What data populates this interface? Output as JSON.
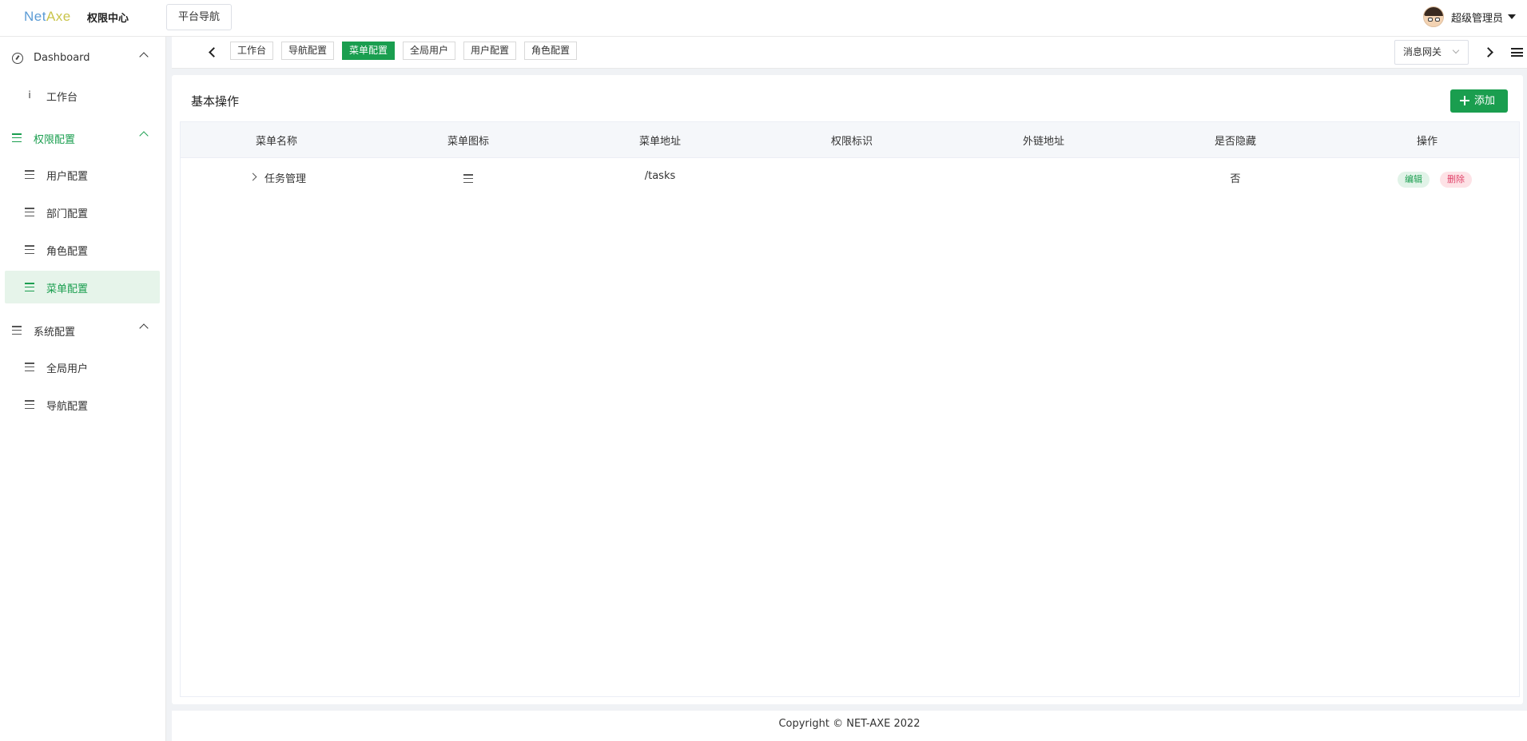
{
  "header": {
    "logo_text_a": "Net",
    "logo_text_b": "Axe",
    "app_title": "权限中心",
    "nav_button": "平台导航",
    "user_name": "超级管理员"
  },
  "sidebar": {
    "groups": [
      {
        "label": "Dashboard",
        "icon": "dashboard-icon",
        "expanded": true,
        "items": [
          {
            "label": "工作台",
            "icon": "info-icon"
          }
        ]
      },
      {
        "label": "权限配置",
        "icon": "menu-icon",
        "expanded": true,
        "active": true,
        "items": [
          {
            "label": "用户配置",
            "icon": "menu-icon"
          },
          {
            "label": "部门配置",
            "icon": "menu-icon"
          },
          {
            "label": "角色配置",
            "icon": "menu-icon"
          },
          {
            "label": "菜单配置",
            "icon": "menu-icon",
            "active": true
          }
        ]
      },
      {
        "label": "系统配置",
        "icon": "menu-icon",
        "expanded": true,
        "items": [
          {
            "label": "全局用户",
            "icon": "menu-icon"
          },
          {
            "label": "导航配置",
            "icon": "menu-icon"
          }
        ]
      }
    ]
  },
  "tabs": {
    "items": [
      "工作台",
      "导航配置",
      "菜单配置",
      "全局用户",
      "用户配置",
      "角色配置"
    ],
    "active_index": 2,
    "gateway_select": "消息网关"
  },
  "main": {
    "card_title": "基本操作",
    "add_button": "添加",
    "table": {
      "columns": [
        "菜单名称",
        "菜单图标",
        "菜单地址",
        "权限标识",
        "外链地址",
        "是否隐藏",
        "操作"
      ],
      "rows": [
        {
          "name": "任务管理",
          "icon": "menu-icon",
          "path": "/tasks",
          "permission": "",
          "external": "",
          "hidden": "否",
          "actions": [
            "编辑",
            "删除"
          ]
        }
      ]
    }
  },
  "footer": {
    "text": "Copyright © NET-AXE 2022"
  },
  "colors": {
    "accent": "#1a9e4f",
    "danger": "#e0446a",
    "active_bg": "#e6f4ea"
  }
}
